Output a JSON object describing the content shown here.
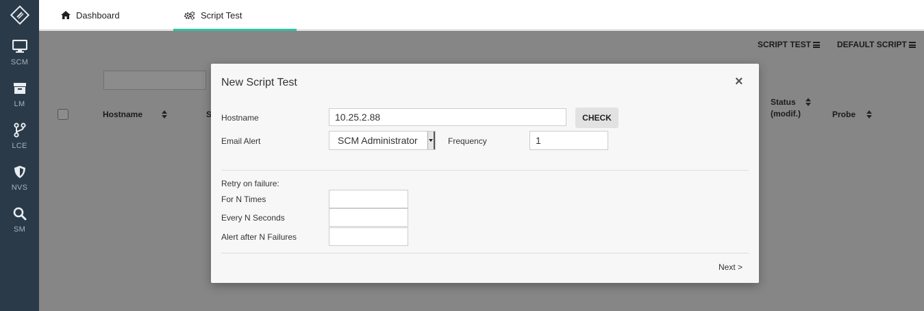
{
  "sidebar": {
    "items": [
      {
        "label": "SCM",
        "icon": "monitor-icon"
      },
      {
        "label": "LM",
        "icon": "archive-icon"
      },
      {
        "label": "LCE",
        "icon": "branch-icon"
      },
      {
        "label": "NVS",
        "icon": "shield-icon"
      },
      {
        "label": "SM",
        "icon": "search-icon"
      }
    ]
  },
  "tabs": {
    "dashboard": "Dashboard",
    "script_test": "Script Test"
  },
  "toolbar": {
    "script_test": "SCRIPT TEST",
    "default_script": "DEFAULT SCRIPT"
  },
  "table": {
    "headers": {
      "hostname": "Hostname",
      "s": "S",
      "status_line1": "Status",
      "status_line2": "(modif.)",
      "probe": "Probe"
    }
  },
  "modal": {
    "title": "New Script Test",
    "close": "×",
    "hostname_label": "Hostname",
    "hostname_value": "10.25.2.88",
    "check_button": "CHECK",
    "email_label": "Email Alert",
    "email_value": "SCM Administrator",
    "frequency_label": "Frequency",
    "frequency_value": "1",
    "retry_label": "Retry on failure:",
    "for_n_times_label": "For N Times",
    "every_n_seconds_label": "Every N Seconds",
    "alert_after_label": "Alert after N Failures",
    "next_button": "Next >"
  },
  "colors": {
    "sidebar_bg": "#2b3a48",
    "accent": "#2fc3a6"
  }
}
